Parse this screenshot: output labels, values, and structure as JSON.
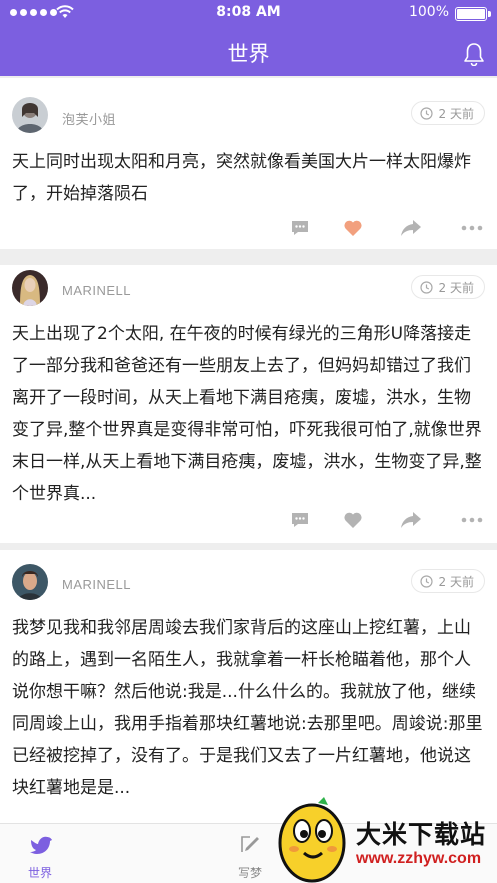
{
  "status": {
    "time": "8:08 AM",
    "battery": "100%"
  },
  "header": {
    "title": "世界"
  },
  "posts": [
    {
      "author": "泡芙小姐",
      "time": "2 天前",
      "text": "天上同时出现太阳和月亮，突然就像看美国大片一样太阳爆炸了，开始掉落陨石",
      "liked": true
    },
    {
      "author": "MARINELL",
      "time": "2 天前",
      "text": "天上出现了2个太阳, 在午夜的时候有绿光的三角形U降落接走了一部分我和爸爸还有一些朋友上去了，但妈妈却错过了我们离开了一段时间，从天上看地下满目疮痍，废墟，洪水，生物变了异,整个世界真是变得非常可怕，吓死我很可怕了,就像世界末日一样,从天上看地下满目疮痍，废墟，洪水，生物变了异,整个世界真...",
      "liked": false
    },
    {
      "author": "MARINELL",
      "time": "2 天前",
      "text": "我梦见我和我邻居周竣去我们家背后的这座山上挖红薯，上山的路上，遇到一名陌生人，我就拿着一杆长枪瞄着他，那个人说你想干嘛？然后他说:我是...什么什么的。我就放了他，继续同周竣上山，我用手指着那块红薯地说:去那里吧。周竣说:那里已经被挖掉了，没有了。于是我们又去了一片红薯地，他说这块红薯地是是...",
      "liked": false
    }
  ],
  "tabs": [
    {
      "label": "世界",
      "icon": "bird-icon"
    },
    {
      "label": "写梦",
      "icon": "pen-icon"
    }
  ],
  "watermark": {
    "text": "大米下载站",
    "url": "www.zzhyw.com"
  },
  "colors": {
    "accent": "#7c5fe0",
    "like": "#f2a07e",
    "icon": "#b0b0b0"
  }
}
